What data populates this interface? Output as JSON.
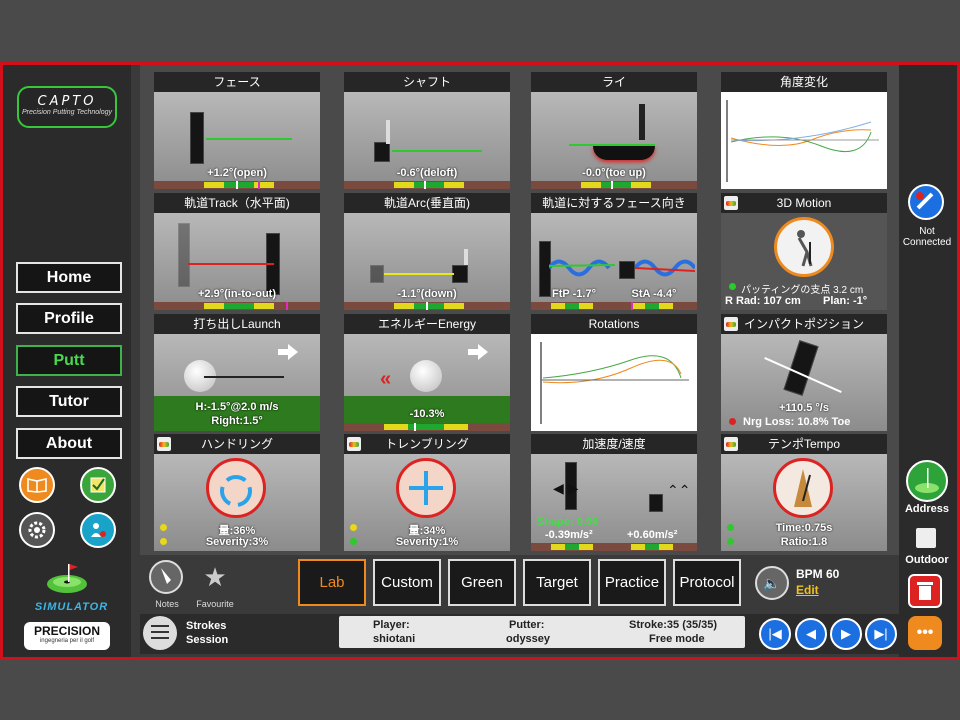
{
  "sidebar": {
    "logo_title": "CAPTO",
    "logo_sub": "Precision Putting Technology",
    "nav": [
      {
        "label": "Home",
        "active": false
      },
      {
        "label": "Profile",
        "active": false
      },
      {
        "label": "Putt",
        "active": true
      },
      {
        "label": "Tutor",
        "active": false
      },
      {
        "label": "About",
        "active": false
      }
    ],
    "simulator_label": "SIMULATOR",
    "brand_main": "PRECISION",
    "brand_sub": "ingegneria per il golf"
  },
  "panels": {
    "face": {
      "title": "フェース",
      "value": "+1.2°(open)"
    },
    "shaft": {
      "title": "シャフト",
      "value": "-0.6°(deloft)"
    },
    "lie": {
      "title": "ライ",
      "value": "-0.0°(toe up)"
    },
    "angle": {
      "title": "角度変化"
    },
    "track": {
      "title": "軌道Track（水平面)",
      "value": "+2.9°(in-to-out)"
    },
    "arc": {
      "title": "軌道Arc(垂直面)",
      "value": "-1.1°(down)"
    },
    "face_to_path": {
      "title": "軌道に対するフェース向き",
      "ftp": "FtP -1.7°",
      "sta": "StA -4.4°"
    },
    "motion3d": {
      "title": "3D Motion",
      "pivot": "パッティングの支点 3.2 cm",
      "rrad": "R Rad: 107 cm",
      "plan": "Plan: -1°"
    },
    "launch": {
      "title": "打ち出しLaunch",
      "h": "H:-1.5°@2.0 m/s",
      "right": "Right:1.5°"
    },
    "energy": {
      "title": "エネルギーEnergy",
      "value": "-10.3%"
    },
    "rotations": {
      "title": "Rotations"
    },
    "impact": {
      "title": "インパクトポジション",
      "deg": "+110.5 °/s",
      "nrg": "Nrg Loss: 10.8% Toe"
    },
    "handring": {
      "title": "ハンドリング",
      "amount": "量:36%",
      "severity": "Severity:3%"
    },
    "trembling": {
      "title": "トレンブリング",
      "amount": "量:34%",
      "severity": "Severity:1%"
    },
    "accel": {
      "title": "加速度/速度",
      "shape": "Shape: 0.96",
      "v1": "-0.39m/s²",
      "v2": "+0.60m/s²"
    },
    "tempo": {
      "title": "テンポTempo",
      "time": "Time:0.75s",
      "ratio": "Ratio:1.8"
    }
  },
  "rightbar": {
    "connection": "Not Connected",
    "address": "Address",
    "outdoor": "Outdoor"
  },
  "bottom": {
    "notes": "Notes",
    "favourite": "Favourite",
    "tabs": [
      {
        "label": "Lab",
        "active": true
      },
      {
        "label": "Custom",
        "active": false
      },
      {
        "label": "Green",
        "active": false
      },
      {
        "label": "Target",
        "active": false
      },
      {
        "label": "Practice",
        "active": false
      },
      {
        "label": "Protocol",
        "active": false
      }
    ],
    "bpm": "BPM 60",
    "edit": "Edit"
  },
  "info": {
    "strokes_line1": "Strokes",
    "strokes_line2": "Session",
    "player_label": "Player:",
    "player": "shiotani",
    "putter_label": "Putter:",
    "putter": "odyssey",
    "stroke_label": "Stroke:35 (35/35)",
    "mode": "Free mode"
  },
  "colors": {
    "accent_red": "#d0111b",
    "active_green": "#4bd84f",
    "active_orange": "#ee8a1e",
    "nav_blue": "#1b6fe0"
  }
}
